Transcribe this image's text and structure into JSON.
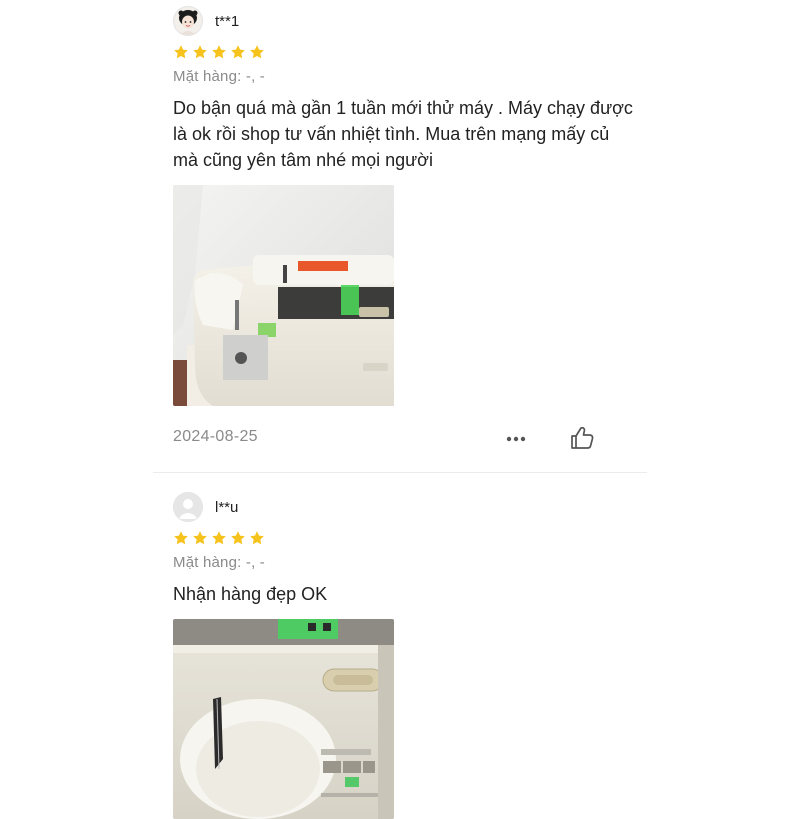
{
  "reviews": [
    {
      "username": "t**1",
      "rating": 5,
      "variant_label": "Mặt hàng: -, -",
      "content": "Do bận quá mà gần 1 tuần mới thử máy . Máy chạy được là ok rồi shop tư vấn nhiệt tình. Mua trên mạng mấy củ mà cũng yên tâm nhé mọi người",
      "photo_icon": "sewing-machine-photo",
      "date": "2024-08-25",
      "more_icon": "more-dots-icon",
      "like_icon": "thumbs-up-icon"
    },
    {
      "username": "l**u",
      "rating": 5,
      "variant_label": "Mặt hàng: -, -",
      "content": "Nhận hàng đẹp OK",
      "photo_icon": "sewing-machine-photo"
    }
  ],
  "colors": {
    "star": "#f6c21c",
    "muted_text": "#8a8a8a",
    "divider": "#ececec"
  }
}
